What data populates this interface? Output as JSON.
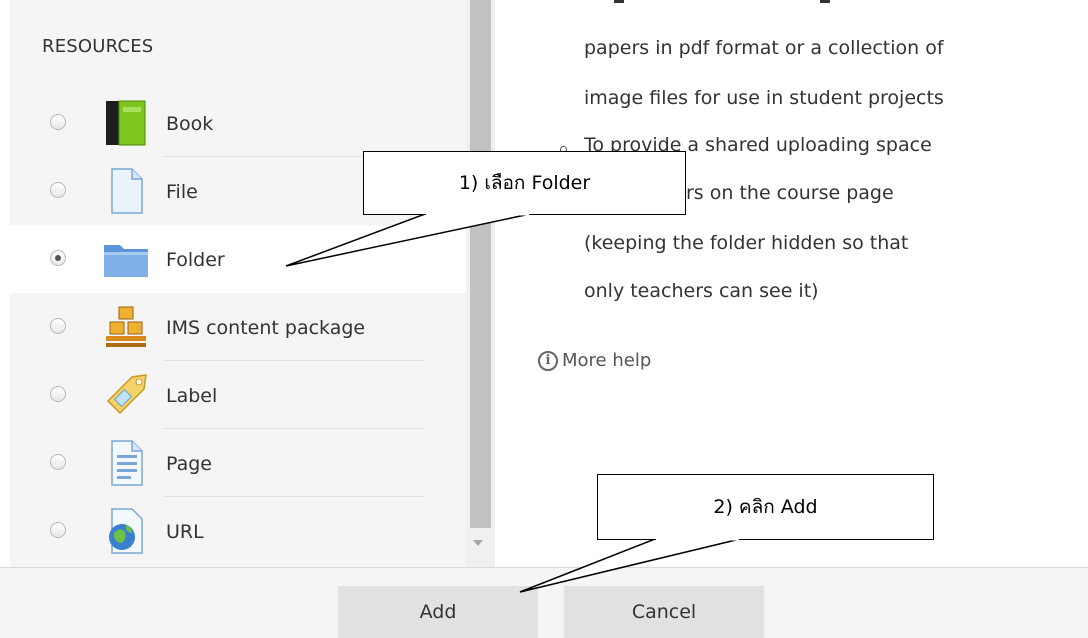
{
  "chooser": {
    "section_title": "RESOURCES",
    "options": [
      {
        "label": "Book",
        "icon": "book-icon",
        "selected": false
      },
      {
        "label": "File",
        "icon": "file-icon",
        "selected": false
      },
      {
        "label": "Folder",
        "icon": "folder-icon",
        "selected": true
      },
      {
        "label": "IMS content package",
        "icon": "ims-package-icon",
        "selected": false
      },
      {
        "label": "Label",
        "icon": "label-tag-icon",
        "selected": false
      },
      {
        "label": "Page",
        "icon": "page-icon",
        "selected": false
      },
      {
        "label": "URL",
        "icon": "url-globe-icon",
        "selected": false
      }
    ]
  },
  "help": {
    "lines": [
      "papers in pdf format or a collection of",
      "image files for use in student projects",
      "To provide a shared uploading space",
      "rs on the course page",
      "(keeping the folder hidden so that",
      "only teachers can see it)"
    ],
    "more_help": "More help"
  },
  "footer": {
    "add_label": "Add",
    "cancel_label": "Cancel"
  },
  "annotations": {
    "step1": "1) เลือก Folder",
    "step2": "2) คลิก Add"
  },
  "colors": {
    "panel_bg": "#f5f5f5",
    "selected_bg": "#ffffff",
    "button_bg": "#e1e1e1",
    "book_green": "#7ec51f",
    "folder_blue": "#4d8ed1"
  }
}
